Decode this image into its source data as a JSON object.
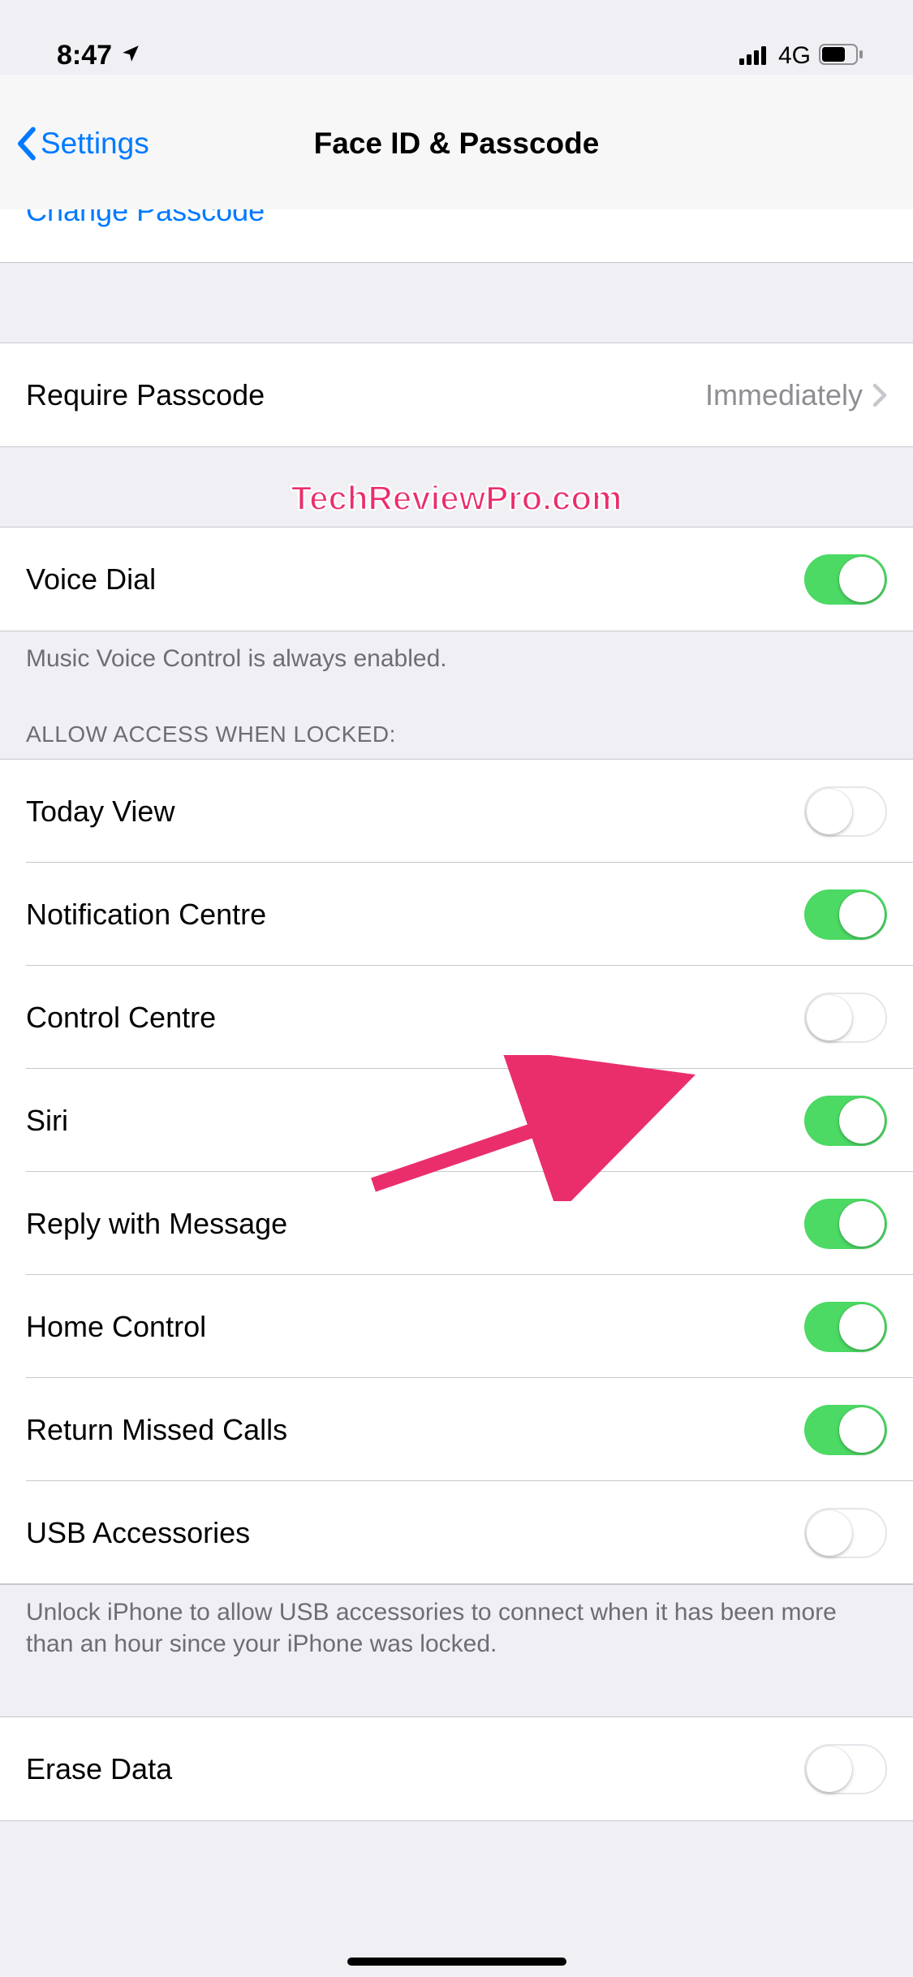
{
  "status": {
    "time": "8:47",
    "network": "4G"
  },
  "nav": {
    "back": "Settings",
    "title": "Face ID & Passcode"
  },
  "rows": {
    "change_passcode": "Change Passcode",
    "require_passcode": {
      "label": "Require Passcode",
      "value": "Immediately"
    },
    "voice_dial": "Voice Dial",
    "voice_dial_footer": "Music Voice Control is always enabled.",
    "allow_header": "ALLOW ACCESS WHEN LOCKED:",
    "today_view": "Today View",
    "notification_centre": "Notification Centre",
    "control_centre": "Control Centre",
    "siri": "Siri",
    "reply_with_message": "Reply with Message",
    "home_control": "Home Control",
    "return_missed_calls": "Return Missed Calls",
    "usb_accessories": "USB Accessories",
    "usb_footer": "Unlock iPhone to allow USB accessories to connect when it has been more than an hour since your iPhone was locked.",
    "erase_data": "Erase Data"
  },
  "switches": {
    "voice_dial": true,
    "today_view": false,
    "notification_centre": true,
    "control_centre": false,
    "siri": true,
    "reply_with_message": true,
    "home_control": true,
    "return_missed_calls": true,
    "usb_accessories": false,
    "erase_data": false
  },
  "watermark": "TechReviewPro.com"
}
